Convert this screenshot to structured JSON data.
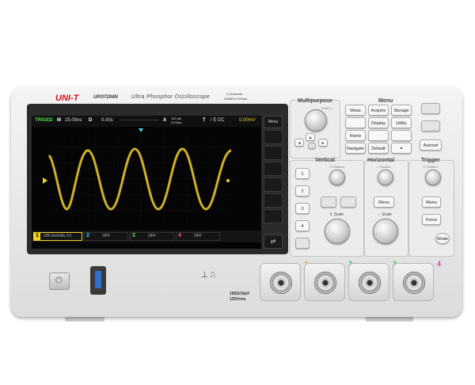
{
  "brand": {
    "logo": "UNI-T",
    "model": "UPO7204N",
    "product_title": "Ultra Phosphor Oscilloscope",
    "channels_label": "4 Channels",
    "spec_label": "200MHz 2GSa/s"
  },
  "screen": {
    "status": {
      "mode": "TRIGED",
      "M": "M",
      "timebase": "25.00ns",
      "D": "D",
      "delay": "0.00s",
      "A": "A",
      "rate": "100 pts\n2GSa/s",
      "T": "T",
      "trigger_info": "/ E DC",
      "trigger_level": "0.00mV"
    },
    "channels": [
      {
        "num": "1",
        "text": "200.0mV/div 1X",
        "color": "#f2d21e"
      },
      {
        "num": "2",
        "text": "OFF",
        "color": "#3fd0f0"
      },
      {
        "num": "3",
        "text": "OFF",
        "color": "#4fe04f"
      },
      {
        "num": "4",
        "text": "OFF",
        "color": "#ff4fb0"
      }
    ],
    "trace_color": "#e6c42a",
    "menu_button": "Menu"
  },
  "multipurpose": {
    "title": "Multipurpose",
    "knob_label": "Push to",
    "buttons": {
      "home": "Home",
      "navigate": "Navigate"
    }
  },
  "menu": {
    "title": "Menu",
    "buttons": {
      "meas": "Meas",
      "acquire": "Acquire",
      "storage": "Storage",
      "display": "Display",
      "utility": "Utility",
      "default": "Default"
    }
  },
  "right_top": {
    "autoset": "Autoset"
  },
  "vertical": {
    "title": "Vertical",
    "position": "⇕ Position",
    "scale": "⇕ Scale",
    "buttons": [
      "1",
      "2",
      "3",
      "4"
    ]
  },
  "horizontal": {
    "title": "Horizontal",
    "position": "⇔ Position",
    "scale": "⇔ Scale",
    "menu": "Menu"
  },
  "trigger": {
    "title": "Trigger",
    "position": "⇕ Position",
    "menu": "Menu",
    "force": "Force",
    "mode": "Mode"
  },
  "inputs": {
    "impedance": "1MΩ//16pF",
    "voltage": "135Vrms",
    "channel_numbers": [
      "1",
      "2",
      "3",
      "4"
    ]
  },
  "colors": {
    "ch1": "#f2d21e",
    "ch2": "#3fd0f0",
    "ch3": "#4fe04f",
    "ch4": "#ff4fb0",
    "logo_red": "#d0121b"
  }
}
